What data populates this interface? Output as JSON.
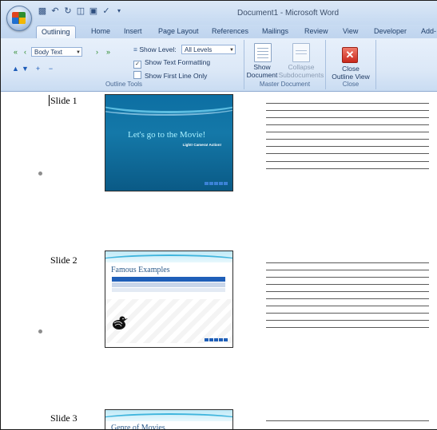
{
  "window": {
    "title": "Document1 - Microsoft Word"
  },
  "quick_access": {
    "icons": [
      "save-icon",
      "undo-icon",
      "redo-icon",
      "print-preview-icon",
      "open-icon",
      "spelling-icon",
      "customize-icon"
    ]
  },
  "tabs": [
    "Outlining",
    "Home",
    "Insert",
    "Page Layout",
    "References",
    "Mailings",
    "Review",
    "View",
    "Developer",
    "Add-"
  ],
  "ribbon": {
    "outline_tools": {
      "label": "Outline Tools",
      "level_combo": "Body Text",
      "show_level_label": "Show Level:",
      "show_level_value": "All Levels",
      "show_text_formatting": "Show Text Formatting",
      "show_first_line_only": "Show First Line Only"
    },
    "master_document": {
      "label": "Master Document",
      "show_document_line1": "Show",
      "show_document_line2": "Document",
      "collapse_line1": "Collapse",
      "collapse_line2": "Subdocuments"
    },
    "close": {
      "label": "Close",
      "close_line1": "Close",
      "close_line2": "Outline View"
    }
  },
  "slides": [
    {
      "label": "Slide 1",
      "title": "Let's go to the Movie!",
      "subtitle": "Light! Camera! Action!"
    },
    {
      "label": "Slide 2",
      "title": "Famous Examples"
    },
    {
      "label": "Slide 3",
      "title": "Genre of Movies"
    }
  ],
  "colors": {
    "ribbon_bg": "#dce8f7",
    "slide1_bg": "#0d6fa3",
    "accent_blue": "#1f5fb8",
    "close_red": "#c9281c"
  }
}
